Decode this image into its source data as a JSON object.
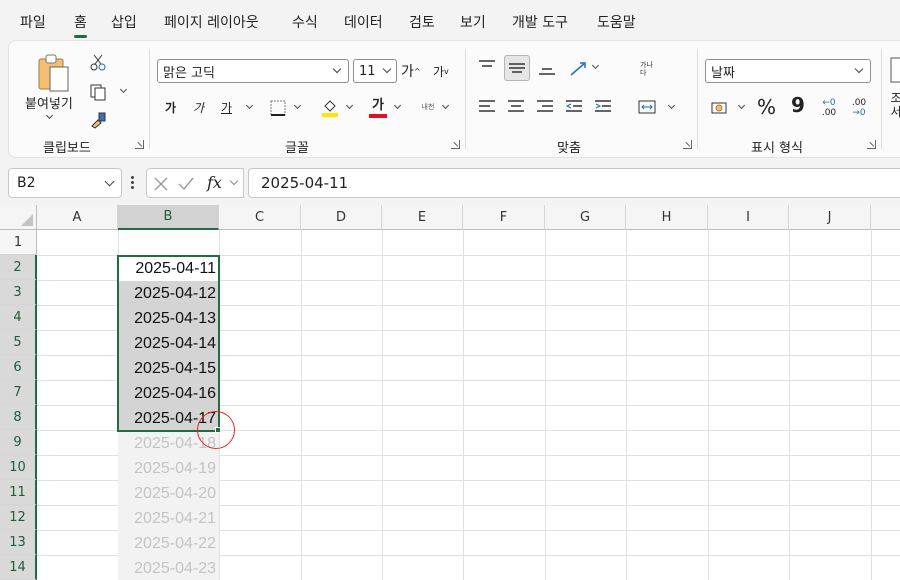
{
  "menu": {
    "tabs": [
      "파일",
      "홈",
      "삽입",
      "페이지 레이아웃",
      "수식",
      "데이터",
      "검토",
      "보기",
      "개발 도구",
      "도움말"
    ],
    "active": "홈"
  },
  "ribbon": {
    "clipboard": {
      "paste_label": "붙여넣기",
      "group_label": "클립보드"
    },
    "font": {
      "font_name": "맑은 고딕",
      "font_size": "11",
      "group_label": "글꼴",
      "bold": "가",
      "italic": "가",
      "underline": "가",
      "font_color": "가",
      "grow": "가",
      "shrink": "가",
      "phonetic": "내천"
    },
    "alignment": {
      "group_label": "맞춤",
      "wrap": "가나다"
    },
    "number": {
      "format": "날짜",
      "group_label": "표시 형식",
      "percent": "%",
      "comma": "9",
      "inc_decimal": ".00",
      "dec_decimal": ".00"
    },
    "partial_label": "조 서"
  },
  "formula_bar": {
    "name_box": "B2",
    "fx": "fx",
    "formula": "2025-04-11"
  },
  "sheet": {
    "columns": [
      "A",
      "B",
      "C",
      "D",
      "E",
      "F",
      "G",
      "H",
      "I",
      "J"
    ],
    "rows": [
      "1",
      "2",
      "3",
      "4",
      "5",
      "6",
      "7",
      "8",
      "9",
      "10",
      "11",
      "12",
      "13",
      "14"
    ],
    "selected_column": "B",
    "cells_filled": [
      "2025-04-11",
      "2025-04-12",
      "2025-04-13",
      "2025-04-14",
      "2025-04-15",
      "2025-04-16",
      "2025-04-17"
    ],
    "cells_preview": [
      "2025-04-18",
      "2025-04-19",
      "2025-04-20",
      "2025-04-21",
      "2025-04-22",
      "2025-04-23"
    ]
  },
  "colors": {
    "accent": "#1e6e42",
    "highlight_circle": "#e0282d"
  }
}
